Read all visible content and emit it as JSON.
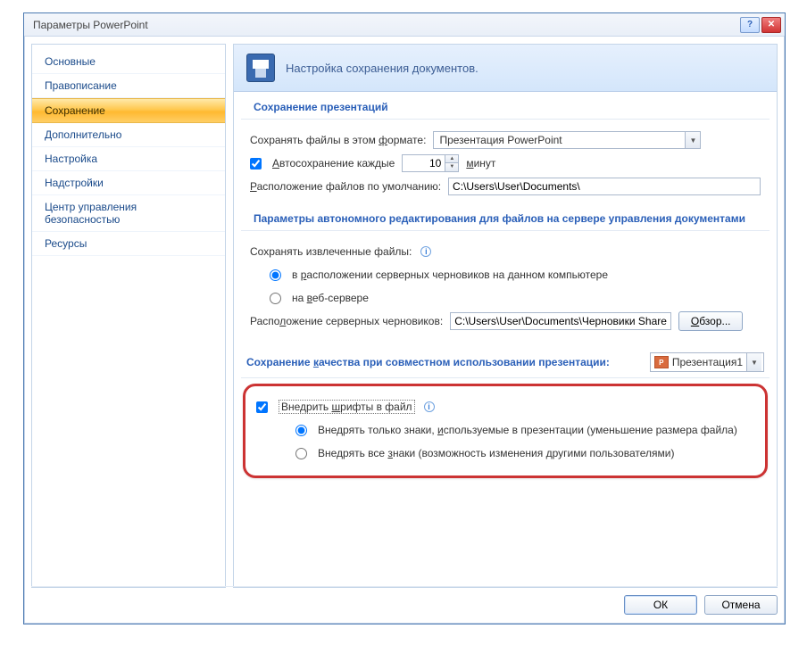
{
  "window": {
    "title": "Параметры PowerPoint"
  },
  "sidebar": {
    "items": [
      {
        "label": "Основные"
      },
      {
        "label": "Правописание"
      },
      {
        "label": "Сохранение",
        "selected": true
      },
      {
        "label": "Дополнительно"
      },
      {
        "label": "Настройка"
      },
      {
        "label": "Надстройки"
      },
      {
        "label": "Центр управления безопасностью"
      },
      {
        "label": "Ресурсы"
      }
    ]
  },
  "header": {
    "text": "Настройка сохранения документов."
  },
  "sections": {
    "save_presentations": {
      "title": "Сохранение презентаций",
      "format_label_pre": "Сохранять файлы в этом ",
      "format_label_u": "ф",
      "format_label_post": "ормате:",
      "format_value": "Презентация PowerPoint",
      "autosave_checked": true,
      "autosave_label_u": "А",
      "autosave_label_post": "втосохранение каждые",
      "autosave_value": "10",
      "autosave_unit_u": "м",
      "autosave_unit_post": "инут",
      "default_loc_label_u": "Р",
      "default_loc_label_post": "асположение файлов по умолчанию:",
      "default_loc_value": "C:\\Users\\User\\Documents\\"
    },
    "offline_editing": {
      "title": "Параметры автономного редактирования для файлов на сервере управления документами",
      "save_extracted_label": "Сохранять извлеченные файлы:",
      "radio1_pre": "в ",
      "radio1_u": "р",
      "radio1_post": "асположении серверных черновиков на данном компьютере",
      "radio2_pre": "на ",
      "radio2_u": "в",
      "radio2_post": "еб-сервере",
      "radio_selected": 0,
      "drafts_label_pre": "Распо",
      "drafts_label_u": "л",
      "drafts_label_post": "ожение серверных черновиков:",
      "drafts_value": "C:\\Users\\User\\Documents\\Черновики SharePo",
      "browse_label": "Обзор..."
    },
    "quality": {
      "title_pre": "Сохранение ",
      "title_u": "к",
      "title_post": "ачества при совместном использовании презентации:",
      "presentation_name": "Презентация1"
    },
    "fonts": {
      "embed_label_pre": "Внедрить ",
      "embed_label_u": "ш",
      "embed_label_post": "рифты в файл",
      "embed_checked": true,
      "r1_pre": "Внедрять только знаки, ",
      "r1_u": "и",
      "r1_post": "спользуемые в презентации (уменьшение размера файла)",
      "r2_pre": "Внедрять все ",
      "r2_u": "з",
      "r2_post": "наки (возможность изменения другими пользователями)",
      "radio_selected": 0
    }
  },
  "footer": {
    "ok": "ОК",
    "cancel": "Отмена"
  }
}
